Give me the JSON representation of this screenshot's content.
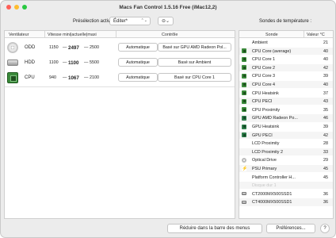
{
  "window": {
    "title": "Macs Fan Control 1.5.16 Free (iMac12,2)"
  },
  "toolbar": {
    "preset_label": "Présélection active :",
    "preset_value": "Éditer*",
    "preset_chevron": "⌃⌄",
    "action_icon": "⊖⌄",
    "sensors_heading": "Sondes de température :"
  },
  "fans": {
    "headers": {
      "fan": "Ventilateur",
      "speed": "Vitesse mini|actuelle|maxi",
      "control": "Contrôle"
    },
    "rows": [
      {
        "icon": "optical-drive-icon",
        "name": "ODD",
        "min": "1150",
        "current": "2497",
        "max": "2500",
        "mode": "Automatique",
        "control": "Basé sur GPU AMD Radeon Pol..."
      },
      {
        "icon": "hard-drive-icon",
        "name": "HDD",
        "min": "1100",
        "current": "1100",
        "max": "5500",
        "mode": "Automatique",
        "control": "Basé sur Ambient"
      },
      {
        "icon": "cpu-chip-icon",
        "name": "CPU",
        "min": "940",
        "current": "1067",
        "max": "2100",
        "mode": "Automatique",
        "control": "Basé sur CPU Core 1"
      }
    ],
    "dash": "—"
  },
  "sensors": {
    "headers": {
      "sensor": "Sonde",
      "value": "Valeur °C"
    },
    "rows": [
      {
        "icon": "none",
        "name": "Ambient",
        "value": "21"
      },
      {
        "icon": "cpu",
        "name": "CPU Core (average)",
        "value": "40"
      },
      {
        "icon": "cpu",
        "name": "CPU Core 1",
        "value": "40"
      },
      {
        "icon": "cpu",
        "name": "CPU Core 2",
        "value": "42"
      },
      {
        "icon": "cpu",
        "name": "CPU Core 3",
        "value": "39"
      },
      {
        "icon": "cpu",
        "name": "CPU Core 4",
        "value": "40"
      },
      {
        "icon": "cpu",
        "name": "CPU Heatsink",
        "value": "37"
      },
      {
        "icon": "cpu",
        "name": "CPU PECI",
        "value": "43"
      },
      {
        "icon": "cpu",
        "name": "CPU Proximity",
        "value": "35"
      },
      {
        "icon": "gpu",
        "name": "GPU AMD Radeon Po...",
        "value": "46"
      },
      {
        "icon": "gpu",
        "name": "GPU Heatsink",
        "value": "39"
      },
      {
        "icon": "gpu",
        "name": "GPU PECI",
        "value": "42"
      },
      {
        "icon": "none",
        "name": "LCD Proximity",
        "value": "28"
      },
      {
        "icon": "none",
        "name": "LCD Proximity 2",
        "value": "33"
      },
      {
        "icon": "odd",
        "name": "Optical Drive",
        "value": "29"
      },
      {
        "icon": "psu",
        "name": "PSU Primary",
        "value": "45"
      },
      {
        "icon": "none",
        "name": "Platform Controller H...",
        "value": "45"
      },
      {
        "icon": "none",
        "name": "Disque dur 1",
        "value": "",
        "dim": true
      },
      {
        "icon": "hdd",
        "name": "CT2000MX500SSD1",
        "value": "36"
      },
      {
        "icon": "hdd",
        "name": "CT4000MX500SSD1",
        "value": "36"
      }
    ]
  },
  "footer": {
    "hide_label": "Réduire dans la barre des menus",
    "prefs_label": "Préférences...",
    "help_label": "?"
  }
}
